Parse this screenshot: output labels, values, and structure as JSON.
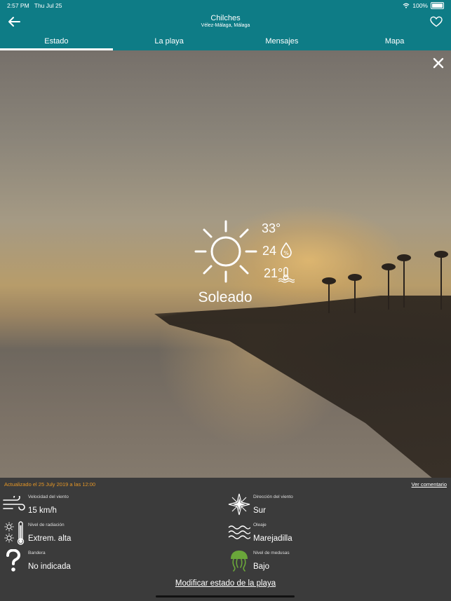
{
  "status_bar": {
    "time": "2:57 PM",
    "date": "Thu Jul 25",
    "battery": "100%"
  },
  "header": {
    "title": "Chilches",
    "subtitle": "Vélez-Málaga, Málaga"
  },
  "tabs": [
    {
      "label": "Estado",
      "active": true
    },
    {
      "label": "La playa",
      "active": false
    },
    {
      "label": "Mensajes",
      "active": false
    },
    {
      "label": "Mapa",
      "active": false
    }
  ],
  "weather": {
    "icon": "sun-icon",
    "air_temp": "33°",
    "humidity": "24",
    "water_temp": "21°",
    "condition": "Soleado"
  },
  "info": {
    "updated": "Actualizado el 25 July 2019 a las 12:00",
    "comment_link": "Ver comentario",
    "wind_speed": {
      "label": "Velocidad del viento",
      "value": "15 km/h",
      "icon": "wind-icon"
    },
    "wind_direction": {
      "label": "Dirección del viento",
      "value": "Sur",
      "icon": "compass-icon"
    },
    "radiation": {
      "label": "Nivel de radiación",
      "value": "Extrem. alta",
      "icon": "thermometer-sun-icon"
    },
    "waves": {
      "label": "Oleaje",
      "value": "Marejadilla",
      "icon": "waves-icon"
    },
    "flag": {
      "label": "Bandera",
      "value": "No indicada",
      "icon": "question-icon"
    },
    "jellyfish": {
      "label": "Nivel de medusas",
      "value": "Bajo",
      "icon": "jellyfish-icon"
    },
    "modify_button": "Modificar estado de la playa"
  },
  "colors": {
    "header": "#0e7c86",
    "panel": "#3b3b3b",
    "accent_orange": "#e49626",
    "jellyfish_green": "#6aa63a"
  }
}
